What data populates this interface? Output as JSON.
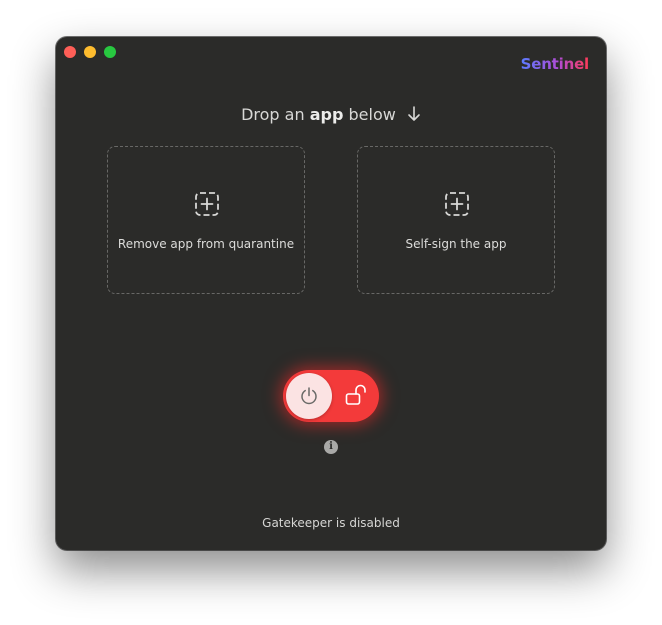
{
  "brand": {
    "title": "Sentinel",
    "gradient": [
      "#5b7cff",
      "#b04cd6",
      "#ff3b57"
    ]
  },
  "header": {
    "prefix": "Drop an",
    "emphasis": "app",
    "suffix": "below",
    "icon": "arrow-down-icon"
  },
  "drop_zones": [
    {
      "label": "Remove app from quarantine",
      "icon": "add-square-icon"
    },
    {
      "label": "Self-sign the app",
      "icon": "add-square-icon"
    }
  ],
  "gatekeeper": {
    "enabled": false,
    "knob_icon": "power-icon",
    "state_icon": "unlock-icon",
    "accent": "#f33a3a",
    "info_icon": "info-icon",
    "status_text": "Gatekeeper is disabled"
  }
}
